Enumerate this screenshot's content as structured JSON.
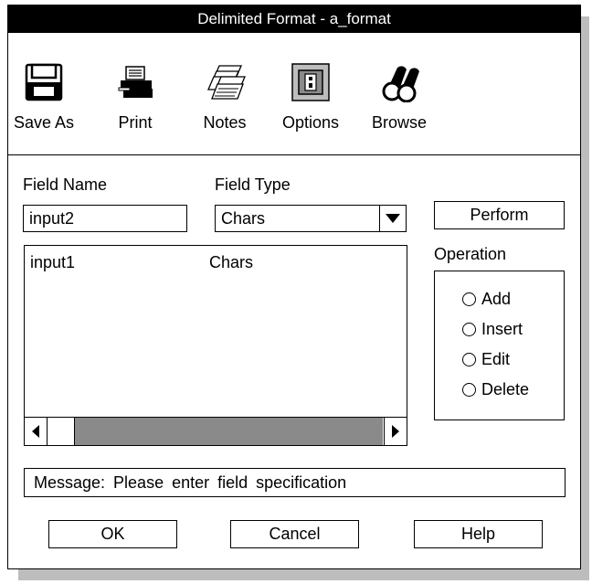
{
  "window": {
    "title": "Delimited Format - a_format"
  },
  "toolbar": [
    {
      "label": "Save As",
      "icon": "floppy-disk-icon"
    },
    {
      "label": "Print",
      "icon": "printer-icon"
    },
    {
      "label": "Notes",
      "icon": "notes-stack-icon"
    },
    {
      "label": "Options",
      "icon": "options-panel-icon"
    },
    {
      "label": "Browse",
      "icon": "binoculars-icon"
    }
  ],
  "form": {
    "field_name_label": "Field Name",
    "field_name_value": "input2",
    "field_type_label": "Field Type",
    "field_type_value": "Chars",
    "perform_label": "Perform"
  },
  "fields_list": {
    "rows": [
      {
        "name": "input1",
        "type": "Chars"
      }
    ]
  },
  "operation": {
    "label": "Operation",
    "options": [
      "Add",
      "Insert",
      "Edit",
      "Delete"
    ]
  },
  "message": "Message: Please enter field specification",
  "buttons": {
    "ok": "OK",
    "cancel": "Cancel",
    "help": "Help"
  }
}
